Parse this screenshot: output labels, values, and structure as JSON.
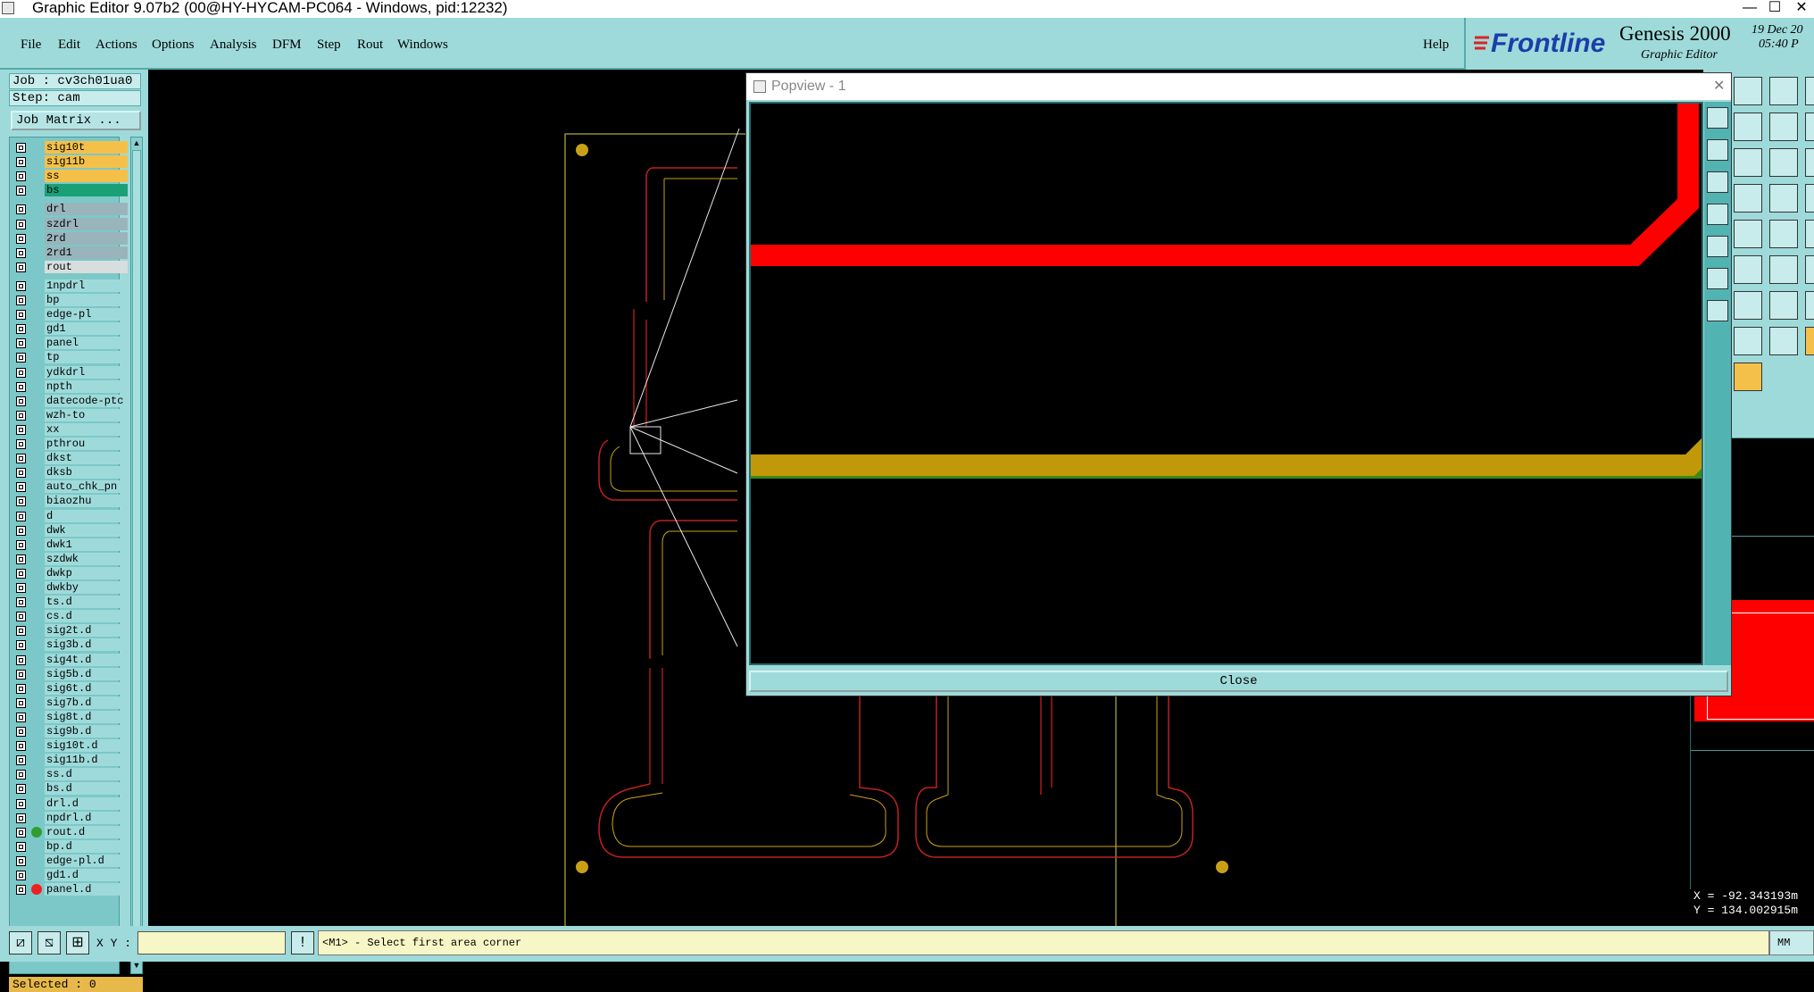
{
  "window": {
    "title": "Graphic Editor 9.07b2 (00@HY-HYCAM-PC064 - Windows, pid:12232)",
    "minimize": "—",
    "maximize": "☐",
    "close": "✕"
  },
  "menu": {
    "items": [
      "File",
      "Edit",
      "Actions",
      "Options",
      "Analysis",
      "DFM",
      "Step",
      "Rout",
      "Windows"
    ],
    "help": "Help"
  },
  "brand": {
    "logo": "Frontline",
    "product": "Genesis 2000",
    "subtitle": "Graphic Editor",
    "date": "19 Dec 20",
    "time": "05:40 P"
  },
  "left_panel": {
    "job": "Job : cv3ch01ua0",
    "step": "Step: cam",
    "job_matrix": "Job Matrix ...",
    "selected": "Selected : 0",
    "layers": [
      {
        "name": "sig10t",
        "color": "#f5c04a"
      },
      {
        "name": "sig11b",
        "color": "#f5c04a"
      },
      {
        "name": "ss",
        "color": "#f5c04a"
      },
      {
        "name": "bs",
        "color": "#1aa077"
      },
      {
        "name": "drl",
        "color": "#9ab4bc"
      },
      {
        "name": "szdrl",
        "color": "#9ab4bc"
      },
      {
        "name": "2rd",
        "color": "#9ab4bc"
      },
      {
        "name": "2rd1",
        "color": "#9ab4bc"
      },
      {
        "name": "rout",
        "color": "#d8dede"
      },
      {
        "name": "1npdrl",
        "color": "#9fdada"
      },
      {
        "name": "bp",
        "color": "#9fdada"
      },
      {
        "name": "edge-pl",
        "color": "#9fdada"
      },
      {
        "name": "gd1",
        "color": "#9fdada"
      },
      {
        "name": "panel",
        "color": "#9fdada"
      },
      {
        "name": "tp",
        "color": "#9fdada"
      },
      {
        "name": "ydkdrl",
        "color": "#9fdada"
      },
      {
        "name": "npth",
        "color": "#9fdada"
      },
      {
        "name": "datecode-ptc",
        "color": "#9fdada"
      },
      {
        "name": "wzh-to",
        "color": "#9fdada"
      },
      {
        "name": "xx",
        "color": "#9fdada"
      },
      {
        "name": "pthrou",
        "color": "#9fdada"
      },
      {
        "name": "dkst",
        "color": "#9fdada"
      },
      {
        "name": "dksb",
        "color": "#9fdada"
      },
      {
        "name": "auto_chk_pn",
        "color": "#9fdada"
      },
      {
        "name": "biaozhu",
        "color": "#9fdada"
      },
      {
        "name": "d",
        "color": "#9fdada"
      },
      {
        "name": "dwk",
        "color": "#9fdada"
      },
      {
        "name": "dwk1",
        "color": "#9fdada"
      },
      {
        "name": "szdwk",
        "color": "#9fdada"
      },
      {
        "name": "dwkp",
        "color": "#9fdada"
      },
      {
        "name": "dwkby",
        "color": "#9fdada"
      },
      {
        "name": "ts.d",
        "color": "#9fdada"
      },
      {
        "name": "cs.d",
        "color": "#9fdada"
      },
      {
        "name": "sig2t.d",
        "color": "#9fdada"
      },
      {
        "name": "sig3b.d",
        "color": "#9fdada"
      },
      {
        "name": "sig4t.d",
        "color": "#9fdada"
      },
      {
        "name": "sig5b.d",
        "color": "#9fdada"
      },
      {
        "name": "sig6t.d",
        "color": "#9fdada"
      },
      {
        "name": "sig7b.d",
        "color": "#9fdada"
      },
      {
        "name": "sig8t.d",
        "color": "#9fdada"
      },
      {
        "name": "sig9b.d",
        "color": "#9fdada"
      },
      {
        "name": "sig10t.d",
        "color": "#9fdada"
      },
      {
        "name": "sig11b.d",
        "color": "#9fdada"
      },
      {
        "name": "ss.d",
        "color": "#9fdada"
      },
      {
        "name": "bs.d",
        "color": "#9fdada"
      },
      {
        "name": "drl.d",
        "color": "#9fdada"
      },
      {
        "name": "npdrl.d",
        "color": "#9fdada"
      },
      {
        "name": "rout.d",
        "color": "#9fdada"
      },
      {
        "name": "bp.d",
        "color": "#9fdada"
      },
      {
        "name": "edge-pl.d",
        "color": "#9fdada"
      },
      {
        "name": "gd1.d",
        "color": "#9fdada"
      },
      {
        "name": "panel.d",
        "color": "#9fdada"
      }
    ]
  },
  "popview": {
    "title": "Popview - 1",
    "close_label": "Close"
  },
  "bottom": {
    "xy_label": "X Y :",
    "xy_value": "",
    "status": "<M1> - Select first area corner",
    "unit": "MM"
  },
  "coords": {
    "x": "X = -92.343193m",
    "y": "Y = 134.002915m"
  }
}
